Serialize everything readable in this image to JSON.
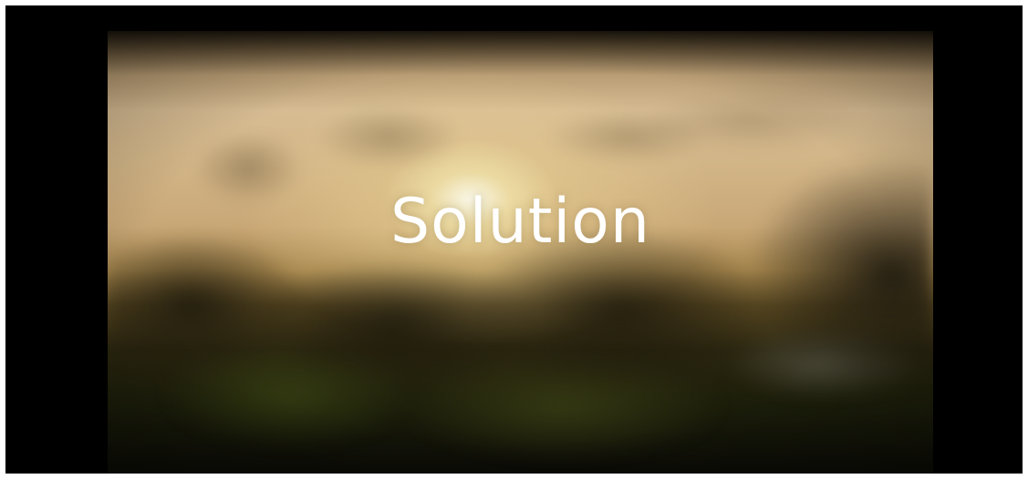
{
  "slide": {
    "title": "Solution"
  },
  "colors": {
    "frame": "#000000",
    "title_text": "#ffffff",
    "sky_warm": "#d7bc93",
    "sun_glow": "#faf9eb"
  }
}
